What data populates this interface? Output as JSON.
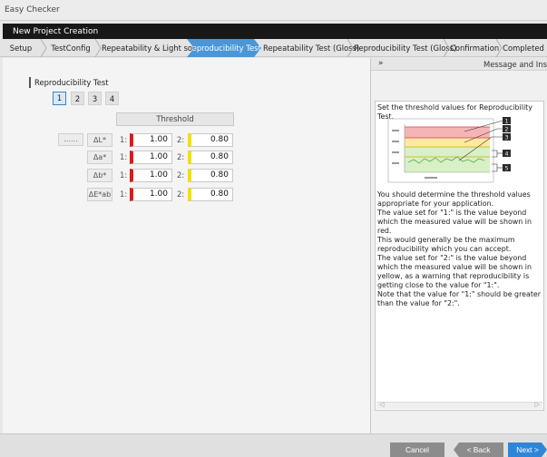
{
  "window": {
    "title": "Easy Checker"
  },
  "header": {
    "title": "New Project Creation"
  },
  "steps": [
    {
      "label": "Setup"
    },
    {
      "label": "TestConfig"
    },
    {
      "label": "Repeatability & Light source"
    },
    {
      "label": "Reproducibility Test"
    },
    {
      "label": "Repeatability Test (Gloss)"
    },
    {
      "label": "Reproducibility Test (Gloss)"
    },
    {
      "label": "Confirmation"
    },
    {
      "label": "Completed"
    }
  ],
  "section": {
    "title": "Reproducibility Test"
  },
  "subtabs": [
    "1",
    "2",
    "3",
    "4"
  ],
  "threshold": {
    "header": "Threshold",
    "dash_label": "......",
    "rows": [
      {
        "metric": "ΔL*",
        "l1": "1:",
        "v1": "1.00",
        "l2": "2:",
        "v2": "0.80"
      },
      {
        "metric": "Δa*",
        "l1": "1:",
        "v1": "1.00",
        "l2": "2:",
        "v2": "0.80"
      },
      {
        "metric": "Δb*",
        "l1": "1:",
        "v1": "1.00",
        "l2": "2:",
        "v2": "0.80"
      },
      {
        "metric": "ΔE*ab",
        "l1": "1:",
        "v1": "1.00",
        "l2": "2:",
        "v2": "0.80"
      }
    ]
  },
  "message_panel": {
    "collapse_glyph": "»",
    "title": "Message and Instructio",
    "lead": "Set the threshold values for Reproducibility Test.",
    "body": [
      "You should determine the threshold values appropriate for your application.",
      "The value set for \"1:\" is the value beyond which the measured value will be shown in red.",
      "This would generally be the maximum reproducibility which you can accept.",
      "The value set for \"2:\" is the value beyond which the measured value will be shown in yellow, as a warning that reproducibility is getting close to the value for \"1:\".",
      "Note that the value for \"1:\" should be greater than the value for \"2:\"."
    ],
    "callouts": [
      "1",
      "2",
      "3",
      "4",
      "5"
    ],
    "scroll_left": "◁",
    "scroll_right": "▷"
  },
  "footer": {
    "cancel": "Cancel",
    "back": "< Back",
    "next": "Next >"
  },
  "colors": {
    "accent": "#4a96d6",
    "danger": "#e01818",
    "warning": "#f2e000",
    "next": "#2f86d8"
  }
}
